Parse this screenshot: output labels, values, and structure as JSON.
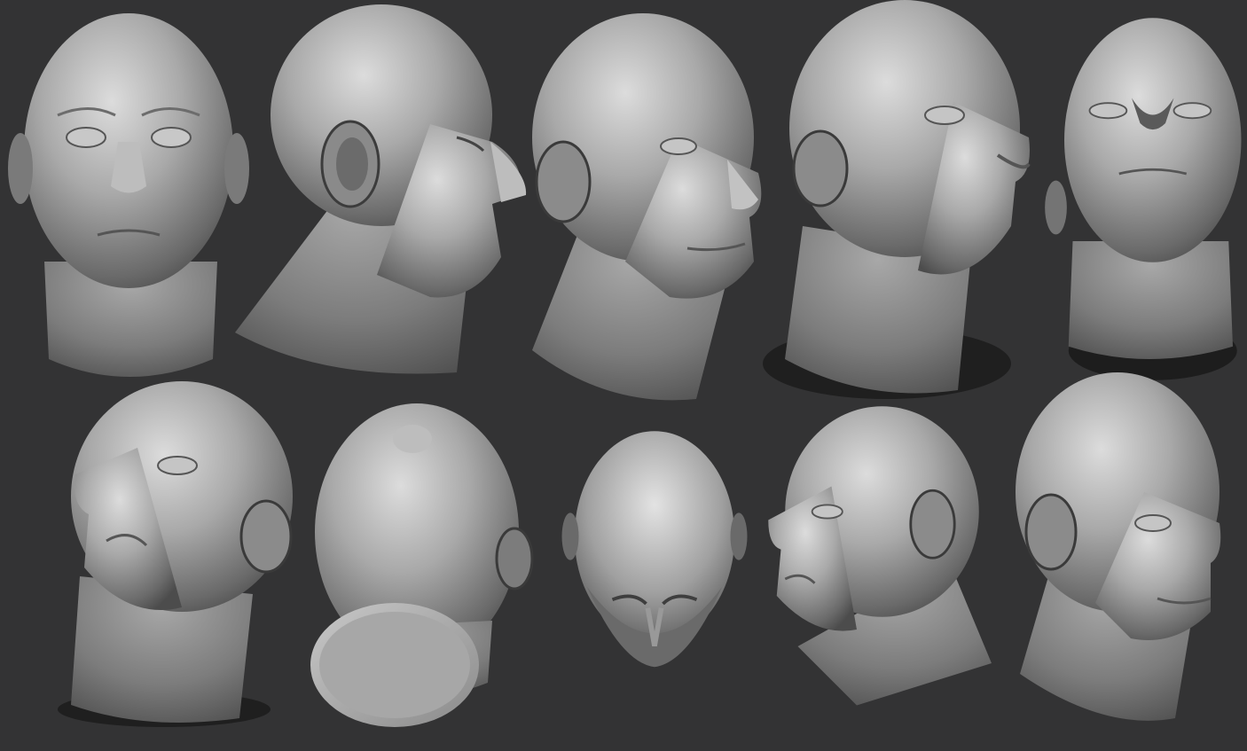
{
  "colors": {
    "background": "#333334",
    "clay_light": "#d2d2d2",
    "clay_mid": "#9a9a9a",
    "clay_dark": "#4a4a4a",
    "cavity": "#2a2a2a"
  },
  "heads": [
    {
      "row": 1,
      "view": "front",
      "facing": "front"
    },
    {
      "row": 1,
      "view": "profile",
      "facing": "right"
    },
    {
      "row": 1,
      "view": "three-quarter",
      "facing": "right"
    },
    {
      "row": 1,
      "view": "three-quarter-up",
      "facing": "right"
    },
    {
      "row": 1,
      "view": "worm-eye-front",
      "facing": "front"
    },
    {
      "row": 2,
      "view": "three-quarter-up",
      "facing": "left"
    },
    {
      "row": 2,
      "view": "underside",
      "facing": "front"
    },
    {
      "row": 2,
      "view": "top-down",
      "facing": "front"
    },
    {
      "row": 2,
      "view": "three-quarter",
      "facing": "left"
    },
    {
      "row": 2,
      "view": "three-quarter",
      "facing": "right"
    }
  ]
}
